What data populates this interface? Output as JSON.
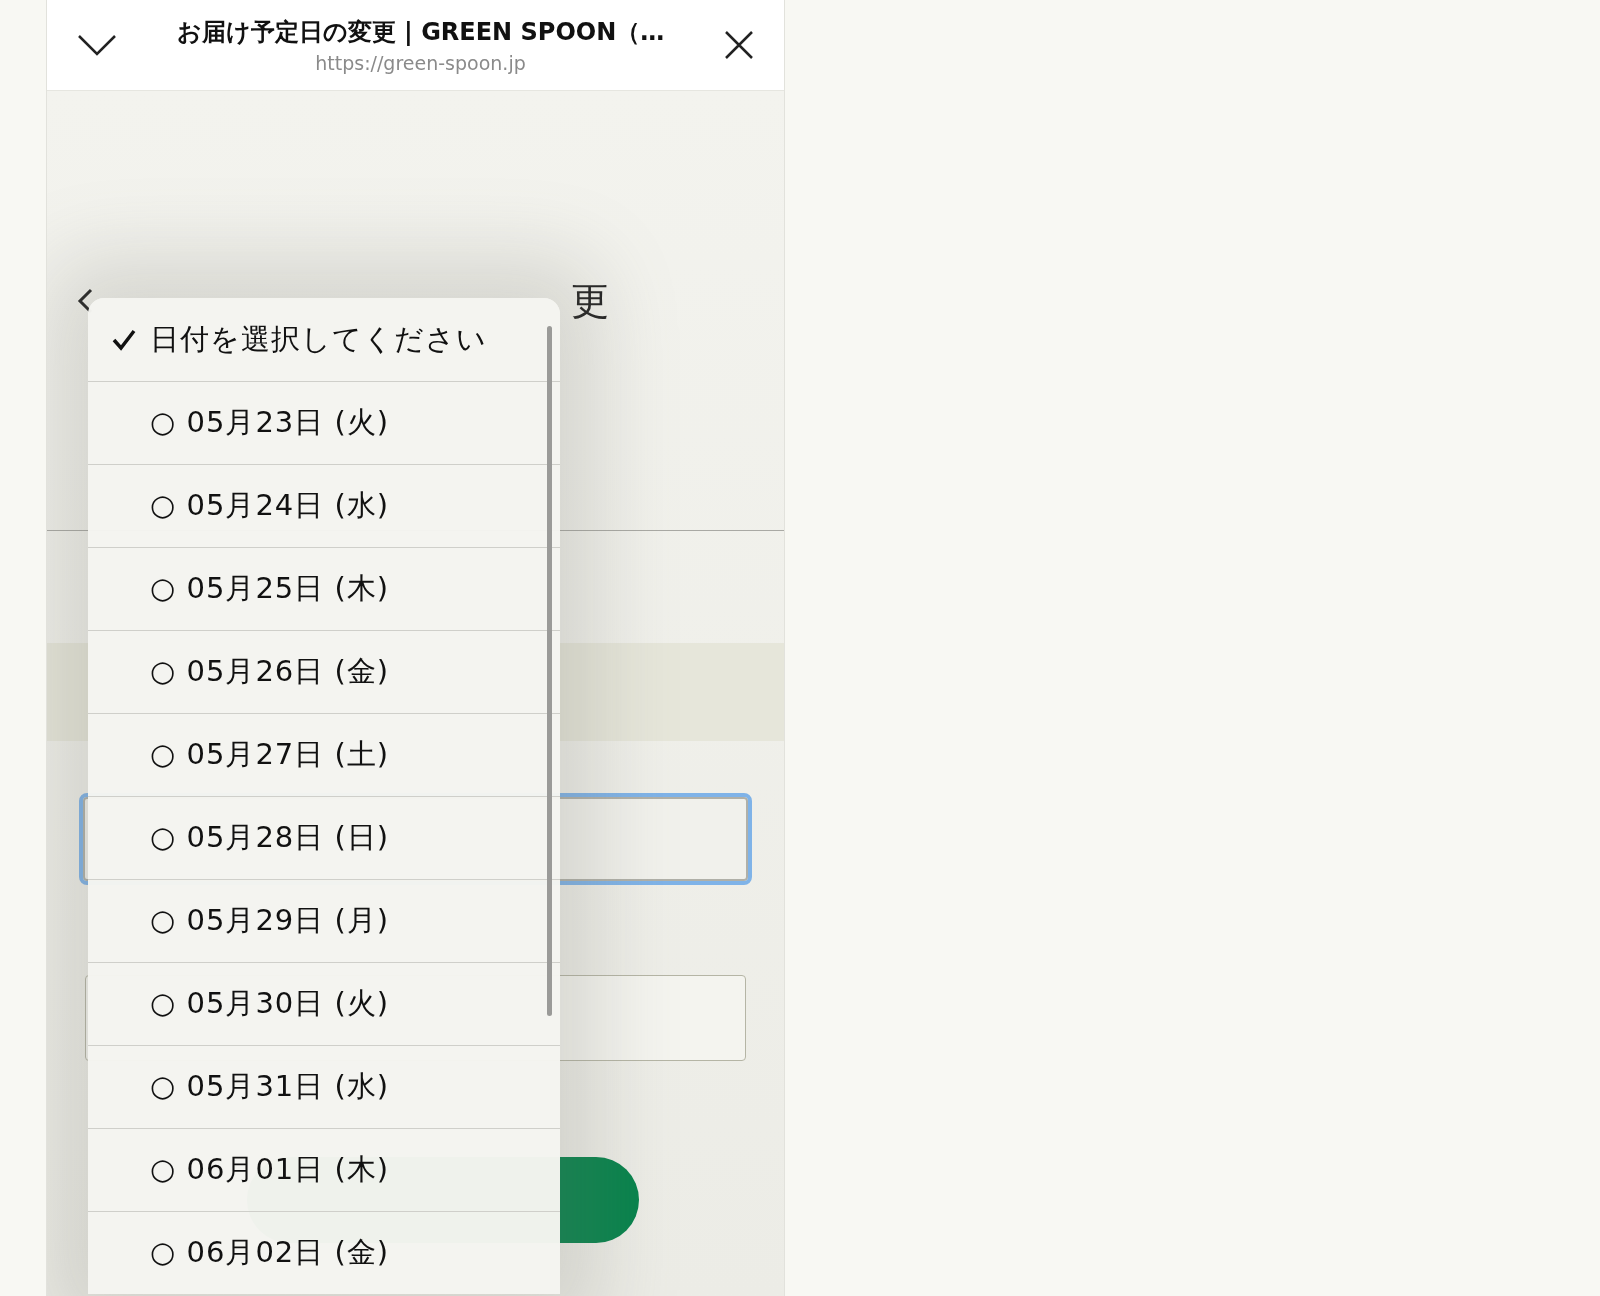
{
  "browser_sheet": {
    "title": "お届け予定日の変更 | GREEN SPOON（…",
    "url": "https://green-spoon.jp"
  },
  "page": {
    "heading": "更"
  },
  "date_menu": {
    "options": [
      {
        "label": "日付を選択してください",
        "selected": true
      },
      {
        "label": "○ 05月23日 (火)",
        "selected": false
      },
      {
        "label": "○ 05月24日 (水)",
        "selected": false
      },
      {
        "label": "○ 05月25日 (木)",
        "selected": false
      },
      {
        "label": "○ 05月26日 (金)",
        "selected": false
      },
      {
        "label": "○ 05月27日 (土)",
        "selected": false
      },
      {
        "label": "○ 05月28日 (日)",
        "selected": false
      },
      {
        "label": "○ 05月29日 (月)",
        "selected": false
      },
      {
        "label": "○ 05月30日 (火)",
        "selected": false
      },
      {
        "label": "○ 05月31日 (水)",
        "selected": false
      },
      {
        "label": "○ 06月01日 (木)",
        "selected": false
      },
      {
        "label": "○ 06月02日 (金)",
        "selected": false
      }
    ]
  }
}
